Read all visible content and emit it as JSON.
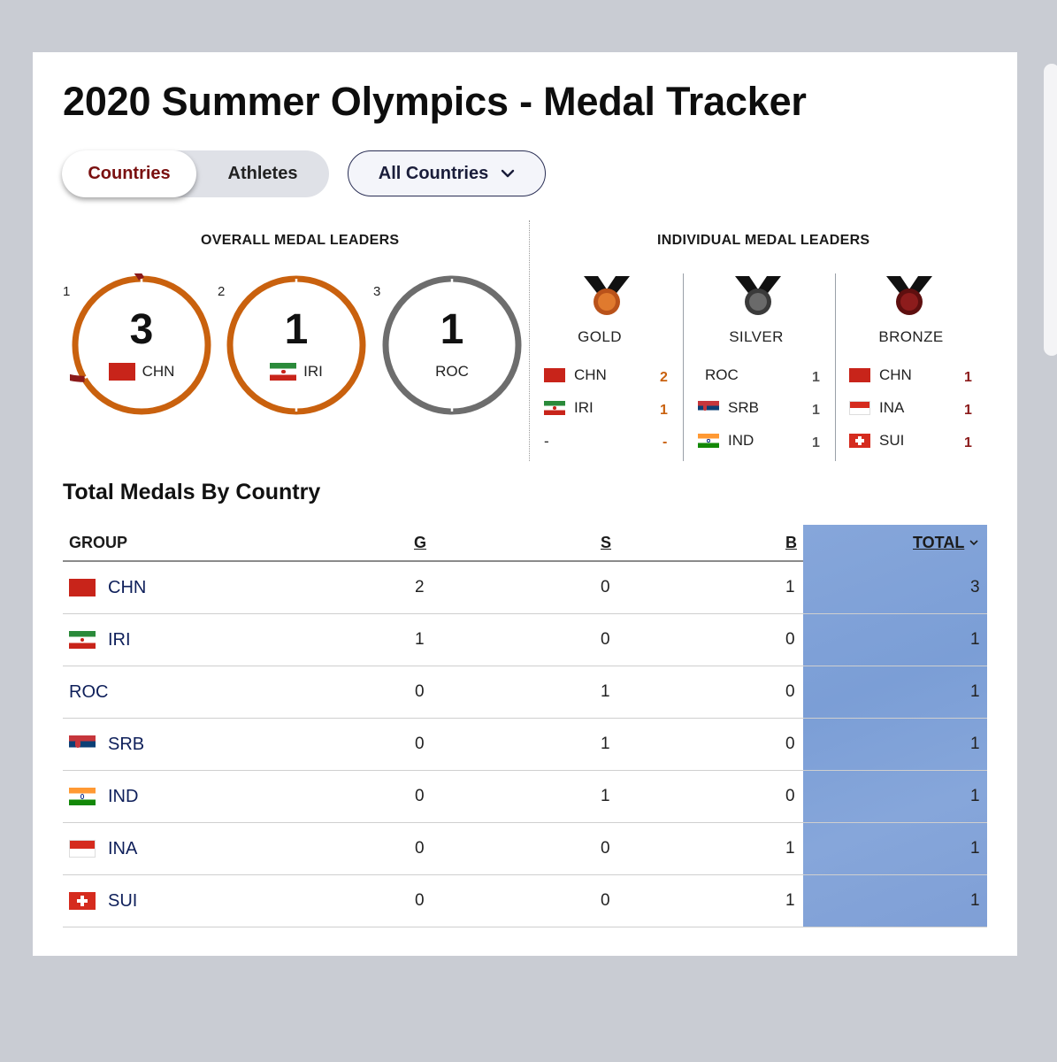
{
  "page_title": "2020 Summer Olympics - Medal Tracker",
  "view_toggle": {
    "countries_label": "Countries",
    "athletes_label": "Athletes",
    "selected": "Countries"
  },
  "filter": {
    "selected": "All Countries"
  },
  "overall": {
    "label": "OVERALL MEDAL LEADERS",
    "leaders": [
      {
        "rank": "1",
        "count": "3",
        "country": "CHN",
        "flag": "chn"
      },
      {
        "rank": "2",
        "count": "1",
        "country": "IRI",
        "flag": "iri"
      },
      {
        "rank": "3",
        "count": "1",
        "country": "ROC",
        "flag": ""
      }
    ]
  },
  "individual": {
    "label": "INDIVIDUAL MEDAL LEADERS",
    "columns": [
      {
        "medal": "GOLD",
        "color": "#d8601e",
        "rows": [
          {
            "country": "CHN",
            "flag": "chn",
            "value": "2"
          },
          {
            "country": "IRI",
            "flag": "iri",
            "value": "1"
          },
          {
            "country": "-",
            "flag": "",
            "value": "-"
          }
        ]
      },
      {
        "medal": "SILVER",
        "color": "#555555",
        "rows": [
          {
            "country": "ROC",
            "flag": "",
            "value": "1"
          },
          {
            "country": "SRB",
            "flag": "srb",
            "value": "1"
          },
          {
            "country": "IND",
            "flag": "ind",
            "value": "1"
          }
        ]
      },
      {
        "medal": "BRONZE",
        "color": "#8b1a1a",
        "rows": [
          {
            "country": "CHN",
            "flag": "chn",
            "value": "1"
          },
          {
            "country": "INA",
            "flag": "ina",
            "value": "1"
          },
          {
            "country": "SUI",
            "flag": "sui",
            "value": "1"
          }
        ]
      }
    ]
  },
  "table": {
    "title": "Total Medals By Country",
    "headers": {
      "group": "GROUP",
      "g": "G",
      "s": "S",
      "b": "B",
      "total": "TOTAL"
    },
    "sort_column": "TOTAL",
    "rows": [
      {
        "country": "CHN",
        "flag": "chn",
        "g": "2",
        "s": "0",
        "b": "1",
        "total": "3"
      },
      {
        "country": "IRI",
        "flag": "iri",
        "g": "1",
        "s": "0",
        "b": "0",
        "total": "1"
      },
      {
        "country": "ROC",
        "flag": "",
        "g": "0",
        "s": "1",
        "b": "0",
        "total": "1"
      },
      {
        "country": "SRB",
        "flag": "srb",
        "g": "0",
        "s": "1",
        "b": "0",
        "total": "1"
      },
      {
        "country": "IND",
        "flag": "ind",
        "g": "0",
        "s": "1",
        "b": "0",
        "total": "1"
      },
      {
        "country": "INA",
        "flag": "ina",
        "g": "0",
        "s": "0",
        "b": "1",
        "total": "1"
      },
      {
        "country": "SUI",
        "flag": "sui",
        "g": "0",
        "s": "0",
        "b": "1",
        "total": "1"
      }
    ]
  },
  "colors": {
    "gold_ring": "#c9610e",
    "china_red": "#8b1a1a",
    "roc_ring": "#6d6d6d",
    "total_column": "#7fa1d8",
    "link_text": "#0e1f5a"
  }
}
